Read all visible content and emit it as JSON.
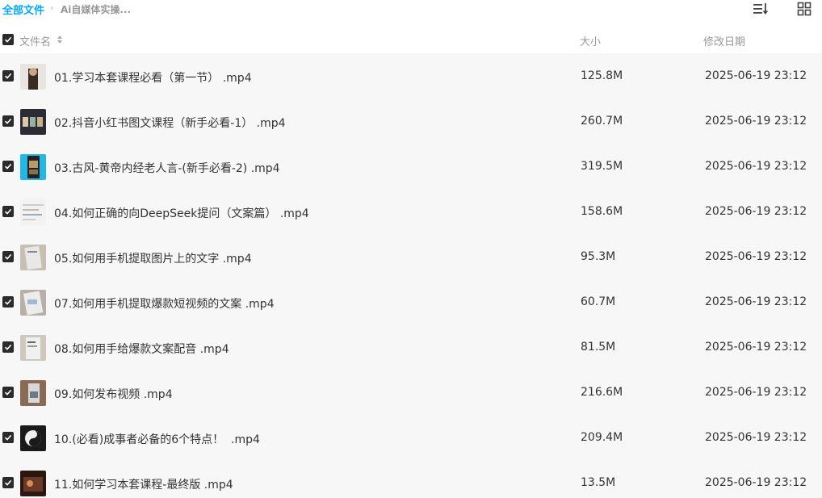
{
  "breadcrumb": {
    "root": "全部文件",
    "separator": "›",
    "current": "Ai自媒体实操..."
  },
  "header": {
    "name": "文件名",
    "size": "大小",
    "date": "修改日期"
  },
  "files": [
    {
      "name": "01.学习本套课程必看（第一节） .mp4",
      "size": "125.8M",
      "date": "2025-06-19 23:12"
    },
    {
      "name": "02.抖音小红书图文课程（新手必看-1） .mp4",
      "size": "260.7M",
      "date": "2025-06-19 23:12"
    },
    {
      "name": "03.古风-黄帝内经老人言-(新手必看-2) .mp4",
      "size": "319.5M",
      "date": "2025-06-19 23:12"
    },
    {
      "name": "04.如何正确的向DeepSeek提问（文案篇） .mp4",
      "size": "158.6M",
      "date": "2025-06-19 23:12"
    },
    {
      "name": "05.如何用手机提取图片上的文字 .mp4",
      "size": "95.3M",
      "date": "2025-06-19 23:12"
    },
    {
      "name": "07.如何用手机提取爆款短视频的文案 .mp4",
      "size": "60.7M",
      "date": "2025-06-19 23:12"
    },
    {
      "name": "08.如何用手给爆款文案配音 .mp4",
      "size": "81.5M",
      "date": "2025-06-19 23:12"
    },
    {
      "name": "09.如何发布视频 .mp4",
      "size": "216.6M",
      "date": "2025-06-19 23:12"
    },
    {
      "name": "10.(必看)成事者必备的6个特点！  .mp4",
      "size": "209.4M",
      "date": "2025-06-19 23:12"
    },
    {
      "name": "11.如何学习本套课程-最终版 .mp4",
      "size": "13.5M",
      "date": "2025-06-19 23:12"
    }
  ],
  "icons": {
    "sort_view": "sort-list-icon",
    "grid_view": "grid-view-icon",
    "checkbox": "check-icon",
    "sort_arrows": "sort-arrows-icon"
  },
  "colors": {
    "accent": "#06a7ff",
    "list_bg": "#f7f7f8",
    "checkbox": "#2b2b2b"
  }
}
